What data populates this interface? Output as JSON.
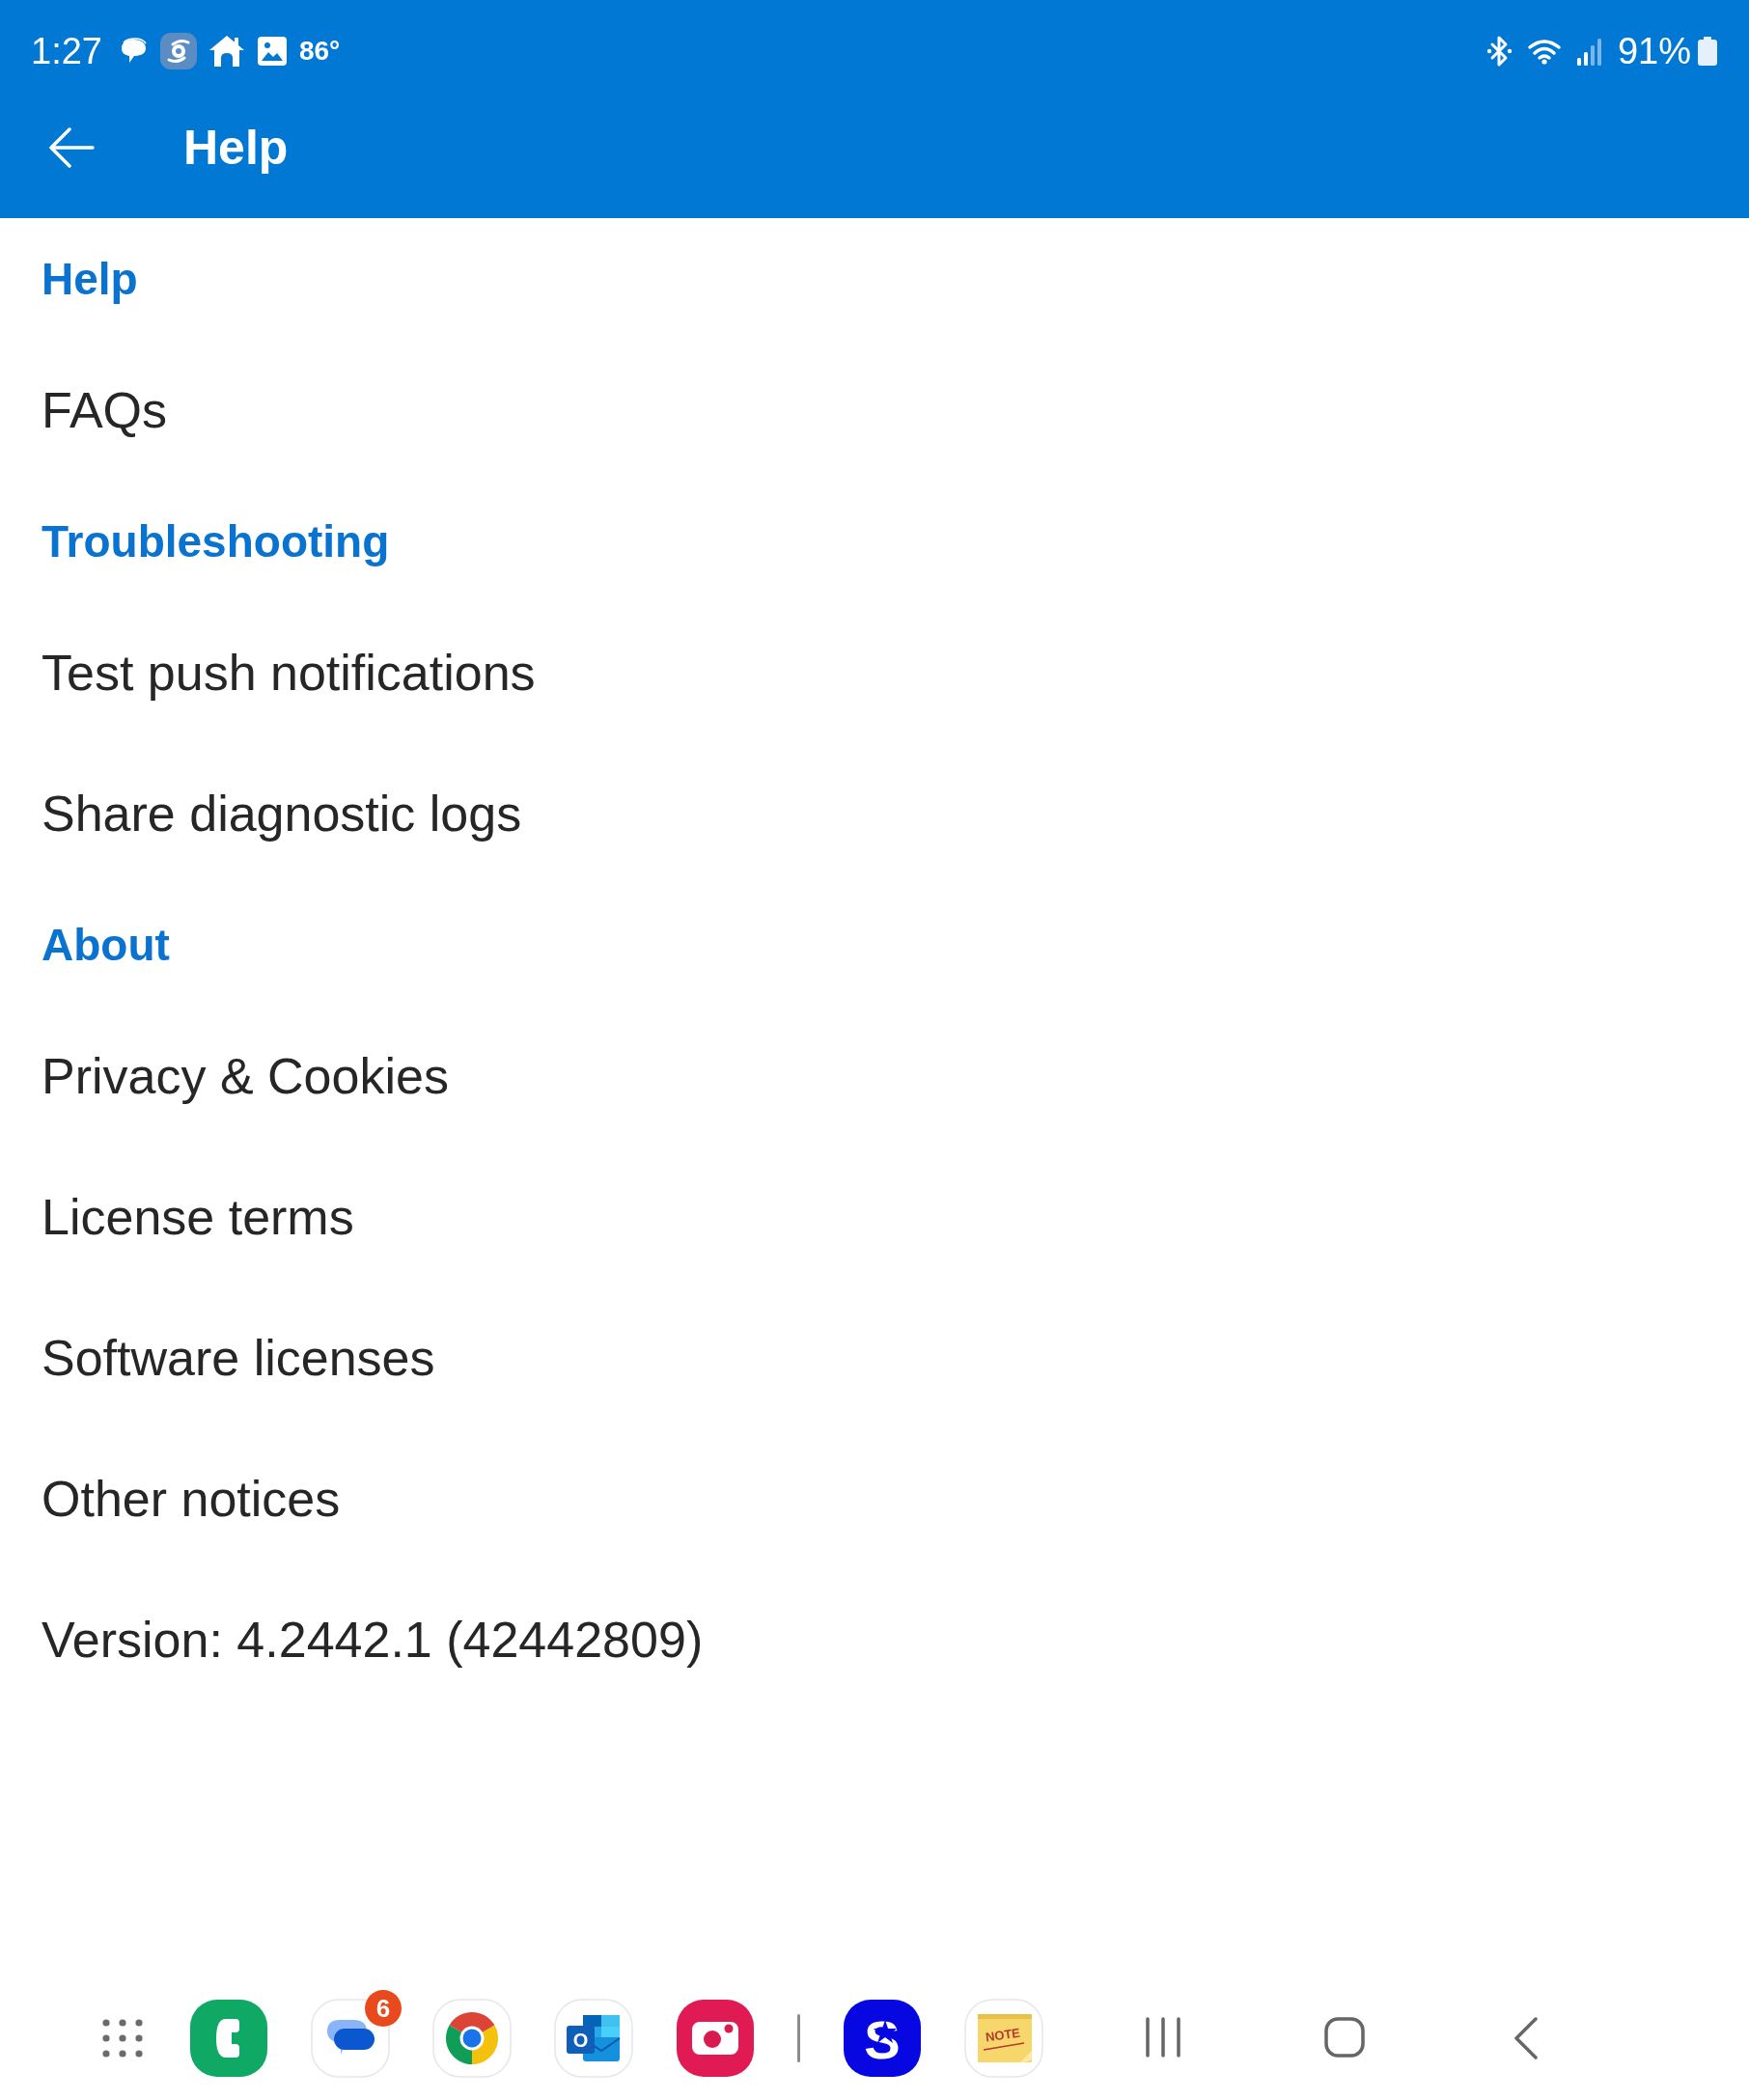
{
  "status_bar": {
    "time": "1:27",
    "temperature": "86°",
    "battery": "91%"
  },
  "app_bar": {
    "title": "Help"
  },
  "items": [
    {
      "kind": "section",
      "text": "Help"
    },
    {
      "kind": "link",
      "text": "FAQs"
    },
    {
      "kind": "section",
      "text": "Troubleshooting"
    },
    {
      "kind": "link",
      "text": "Test push notifications"
    },
    {
      "kind": "link",
      "text": "Share diagnostic logs"
    },
    {
      "kind": "section",
      "text": "About"
    },
    {
      "kind": "link",
      "text": "Privacy & Cookies"
    },
    {
      "kind": "link",
      "text": "License terms"
    },
    {
      "kind": "link",
      "text": "Software licenses"
    },
    {
      "kind": "link",
      "text": "Other notices"
    },
    {
      "kind": "info",
      "text": "Version: 4.2442.1 (42442809)"
    }
  ],
  "taskbar": {
    "pinned_apps": [
      {
        "kind": "phone"
      },
      {
        "kind": "messages",
        "badge": "6"
      },
      {
        "kind": "browser"
      },
      {
        "kind": "mail",
        "label": "O"
      },
      {
        "kind": "camera"
      }
    ],
    "recent_apps": [
      {
        "kind": "sports",
        "label": "S"
      },
      {
        "kind": "notes",
        "label": "NOTE"
      }
    ]
  }
}
